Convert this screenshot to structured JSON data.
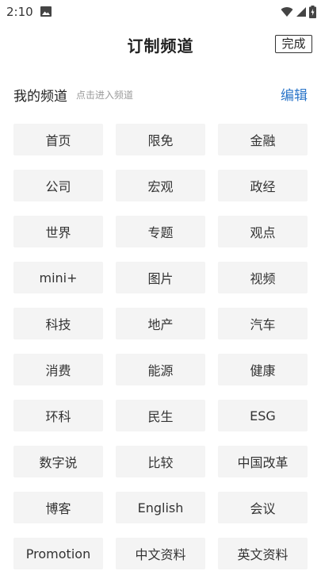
{
  "status_bar": {
    "time": "2:10",
    "icons": [
      "image-icon",
      "wifi-icon",
      "signal-icon",
      "battery-icon"
    ]
  },
  "header": {
    "title": "订制频道",
    "done_label": "完成"
  },
  "section": {
    "title": "我的频道",
    "hint": "点击进入频道",
    "edit_label": "编辑"
  },
  "channels": [
    "首页",
    "限免",
    "金融",
    "公司",
    "宏观",
    "政经",
    "世界",
    "专题",
    "观点",
    "mini+",
    "图片",
    "视频",
    "科技",
    "地产",
    "汽车",
    "消费",
    "能源",
    "健康",
    "环科",
    "民生",
    "ESG",
    "数字说",
    "比较",
    "中国改革",
    "博客",
    "English",
    "会议",
    "Promotion",
    "中文资料",
    "英文资料"
  ],
  "colors": {
    "accent": "#2a75c9",
    "chip_bg": "#f4f4f4",
    "hint_text": "#9a9a9a"
  }
}
